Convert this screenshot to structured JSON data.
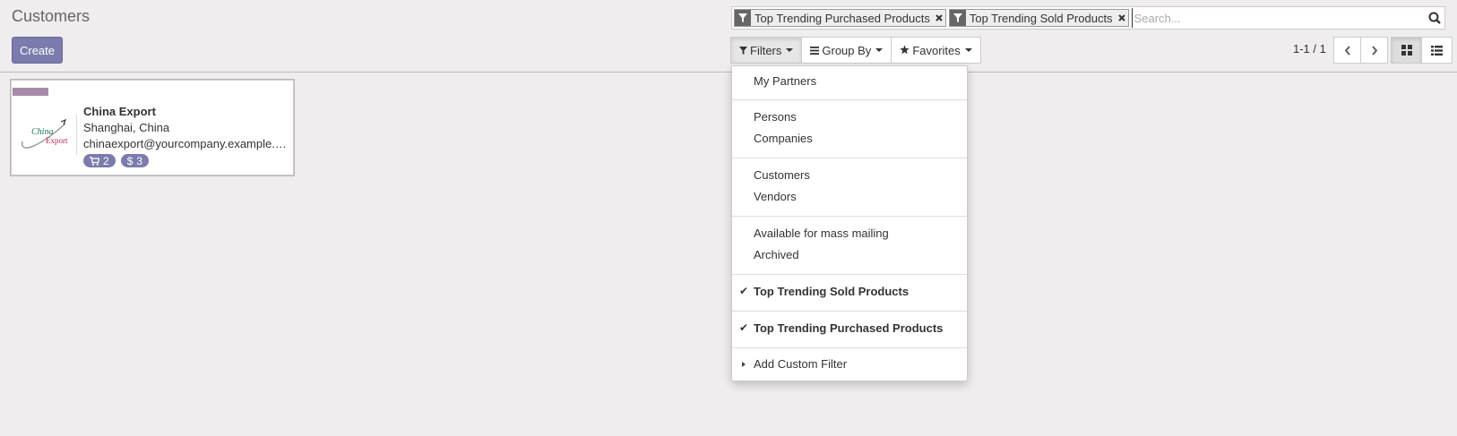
{
  "breadcrumb": {
    "title": "Customers"
  },
  "toolbar": {
    "create_label": "Create"
  },
  "search": {
    "facets": [
      {
        "label": "Top Trending Purchased Products"
      },
      {
        "label": "Top Trending Sold Products"
      }
    ],
    "placeholder": "Search..."
  },
  "filters_bar": {
    "filters_label": "Filters",
    "groupby_label": "Group By",
    "favorites_label": "Favorites"
  },
  "pager": {
    "value": "1-1 / 1"
  },
  "filter_menu": {
    "items": [
      {
        "label": "My Partners"
      },
      {
        "label": "Persons"
      },
      {
        "label": "Companies"
      },
      {
        "label": "Customers"
      },
      {
        "label": "Vendors"
      },
      {
        "label": "Available for mass mailing"
      },
      {
        "label": "Archived"
      },
      {
        "label": "Top Trending Sold Products"
      },
      {
        "label": "Top Trending Purchased Products"
      }
    ],
    "custom_filter_label": "Add Custom Filter"
  },
  "card": {
    "name": "China Export",
    "location": "Shanghai, China",
    "email": "chinaexport@yourcompany.example.com",
    "logo_text_1": "China",
    "logo_text_2": "Export",
    "sale_count": "2",
    "invoice_count": "3",
    "color_tag": "#a88aa8"
  },
  "colors": {
    "accent": "#7c7bad"
  }
}
